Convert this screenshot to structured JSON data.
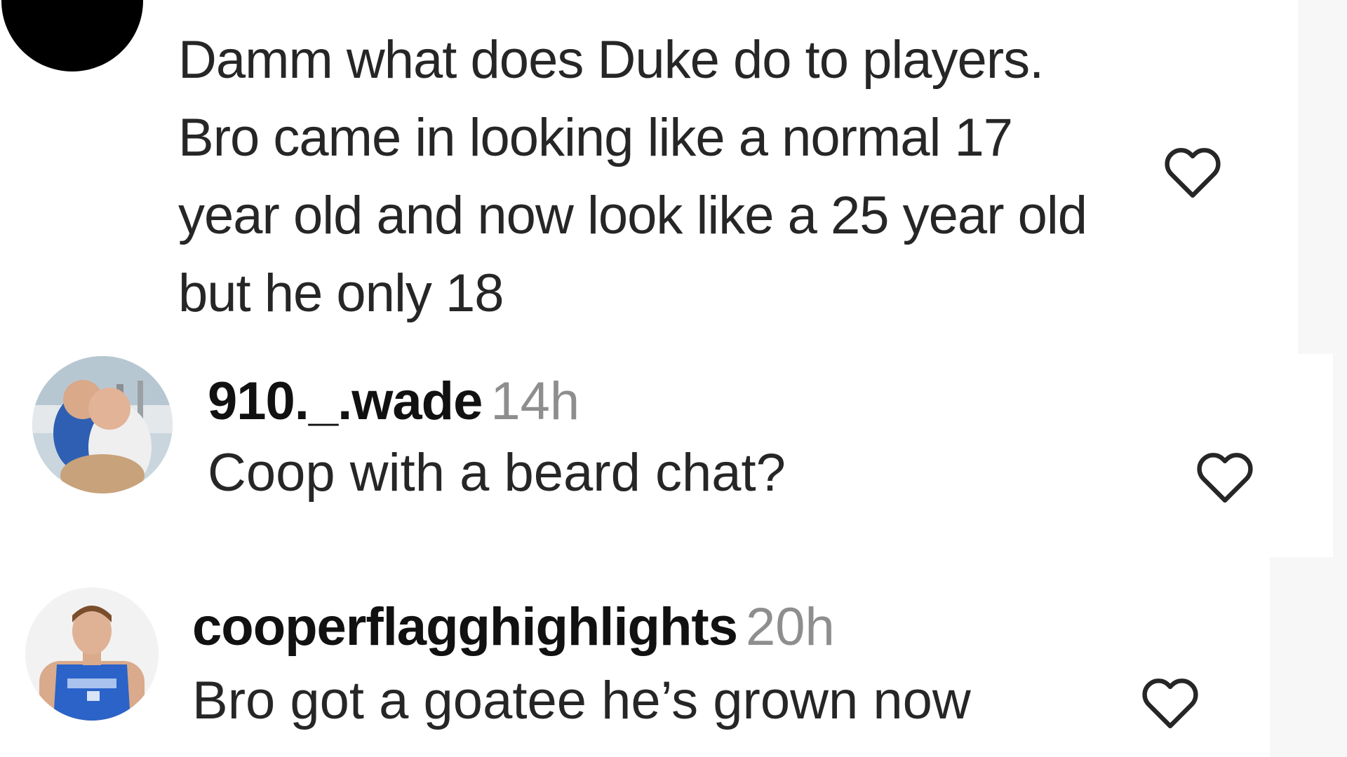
{
  "comments": [
    {
      "text": "Damm what does Duke do to players. Bro came in looking like a normal 17 year old and now look like a 25 year old but he only 18",
      "like_icon": "heart-outline-icon"
    },
    {
      "username": "910._.wade",
      "time": "14h",
      "text": "Coop with a beard chat?",
      "like_icon": "heart-outline-icon"
    },
    {
      "username": "cooperflagghighlights",
      "time": "20h",
      "text": "Bro got a goatee he’s grown now",
      "like_icon": "heart-outline-icon"
    }
  ],
  "colors": {
    "text": "#262626",
    "username": "#111111",
    "timestamp": "#8e8e8e",
    "icon": "#262626",
    "background": "#ffffff"
  }
}
